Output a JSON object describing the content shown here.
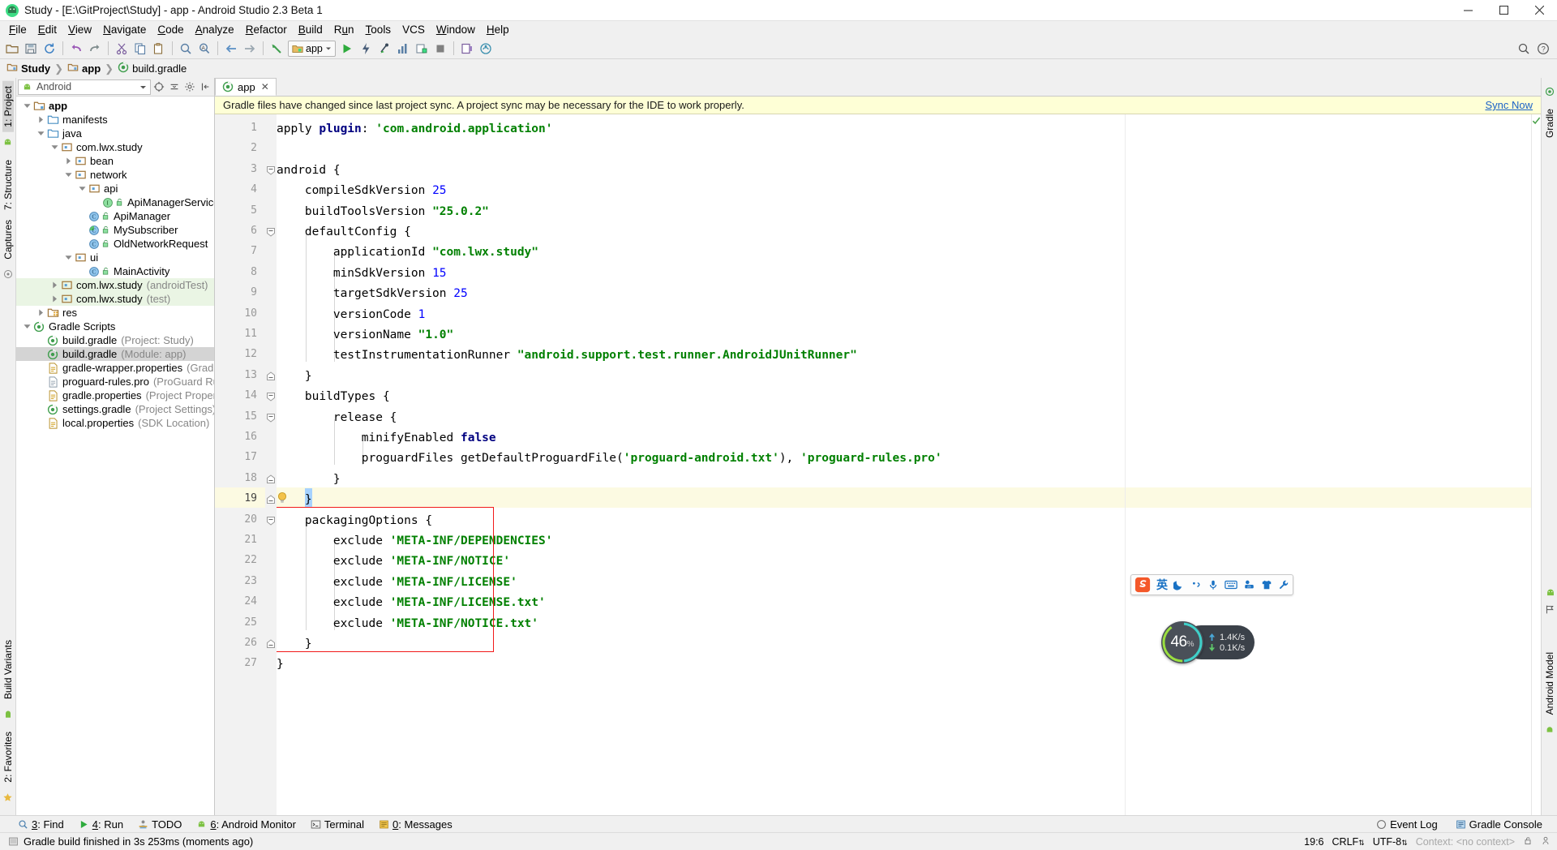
{
  "window": {
    "title": "Study - [E:\\GitProject\\Study] - app - Android Studio 2.3 Beta 1",
    "icon": "android-studio-icon",
    "minimize": "minimize-button",
    "maximize": "maximize-button",
    "close": "close-button"
  },
  "menu": [
    {
      "label": "File",
      "mnemonic": "F"
    },
    {
      "label": "Edit",
      "mnemonic": "E"
    },
    {
      "label": "View",
      "mnemonic": "V"
    },
    {
      "label": "Navigate",
      "mnemonic": "N"
    },
    {
      "label": "Code",
      "mnemonic": "C"
    },
    {
      "label": "Analyze",
      "mnemonic": "A"
    },
    {
      "label": "Refactor",
      "mnemonic": "R"
    },
    {
      "label": "Build",
      "mnemonic": "B"
    },
    {
      "label": "Run",
      "mnemonic": "u"
    },
    {
      "label": "Tools",
      "mnemonic": "T"
    },
    {
      "label": "VCS",
      "mnemonic": ""
    },
    {
      "label": "Window",
      "mnemonic": "W"
    },
    {
      "label": "Help",
      "mnemonic": "H"
    }
  ],
  "toolbar": {
    "run_config": "app",
    "icons": [
      "open-folder-icon",
      "save-all-icon",
      "sync-icon",
      "undo-icon",
      "redo-icon",
      "cut-icon",
      "copy-icon",
      "paste-icon",
      "find-icon",
      "replace-icon",
      "back-icon",
      "forward-icon",
      "sync-project-gradle-icon",
      "run-icon",
      "debug-icon",
      "run-coverage-icon",
      "android-monitor-icon",
      "profiler-icon",
      "stop-icon",
      "avd-manager-icon",
      "sdk-manager-icon"
    ],
    "right_icons": [
      "search-everywhere-icon",
      "help-icon"
    ]
  },
  "breadcrumb": [
    {
      "label": "Study",
      "icon": "module-folder-icon",
      "bold": true
    },
    {
      "label": "app",
      "icon": "module-folder-icon",
      "bold": true
    },
    {
      "label": "build.gradle",
      "icon": "gradle-file-icon",
      "bold": false
    }
  ],
  "left_rail": [
    {
      "label": "1: Project",
      "selected": true
    },
    {
      "label": "7: Structure",
      "selected": false
    },
    {
      "label": "Captures",
      "selected": false
    },
    {
      "label": "Build Variants",
      "selected": false
    },
    {
      "label": "2: Favorites",
      "selected": false
    }
  ],
  "right_rail": [
    {
      "label": "Gradle"
    },
    {
      "label": "Android Model"
    }
  ],
  "project_panel": {
    "view_selector": "Android",
    "view_icon": "android-head-icon",
    "header_buttons": [
      "target-icon",
      "collapse-all-icon",
      "settings-icon",
      "hide-icon"
    ],
    "tree": [
      {
        "depth": 0,
        "twisty": "down",
        "icon": "module-folder-icon",
        "label": "app",
        "sub": "",
        "bold": true,
        "state": "normal"
      },
      {
        "depth": 1,
        "twisty": "right",
        "icon": "folder-icon",
        "label": "manifests",
        "sub": "",
        "bold": false,
        "state": "normal"
      },
      {
        "depth": 1,
        "twisty": "down",
        "icon": "folder-icon",
        "label": "java",
        "sub": "",
        "bold": false,
        "state": "normal"
      },
      {
        "depth": 2,
        "twisty": "down",
        "icon": "package-icon",
        "label": "com.lwx.study",
        "sub": "",
        "bold": false,
        "state": "normal"
      },
      {
        "depth": 3,
        "twisty": "right",
        "icon": "package-icon",
        "label": "bean",
        "sub": "",
        "bold": false,
        "state": "normal"
      },
      {
        "depth": 3,
        "twisty": "down",
        "icon": "package-icon",
        "label": "network",
        "sub": "",
        "bold": false,
        "state": "normal"
      },
      {
        "depth": 4,
        "twisty": "down",
        "icon": "package-icon",
        "label": "api",
        "sub": "",
        "bold": false,
        "state": "normal"
      },
      {
        "depth": 5,
        "twisty": "none",
        "icon": "interface-icon",
        "label": "ApiManagerService",
        "sub": "",
        "bold": false,
        "state": "normal"
      },
      {
        "depth": 4,
        "twisty": "none",
        "icon": "class-icon",
        "label": "ApiManager",
        "sub": "",
        "bold": false,
        "state": "normal"
      },
      {
        "depth": 4,
        "twisty": "none",
        "icon": "class-abstract-icon",
        "label": "MySubscriber",
        "sub": "",
        "bold": false,
        "state": "normal"
      },
      {
        "depth": 4,
        "twisty": "none",
        "icon": "class-icon",
        "label": "OldNetworkRequest",
        "sub": "",
        "bold": false,
        "state": "normal"
      },
      {
        "depth": 3,
        "twisty": "down",
        "icon": "package-icon",
        "label": "ui",
        "sub": "",
        "bold": false,
        "state": "normal"
      },
      {
        "depth": 4,
        "twisty": "none",
        "icon": "class-icon",
        "label": "MainActivity",
        "sub": "",
        "bold": false,
        "state": "normal"
      },
      {
        "depth": 2,
        "twisty": "right",
        "icon": "package-icon",
        "label": "com.lwx.study",
        "sub": "(androidTest)",
        "bold": false,
        "state": "test"
      },
      {
        "depth": 2,
        "twisty": "right",
        "icon": "package-icon",
        "label": "com.lwx.study",
        "sub": "(test)",
        "bold": false,
        "state": "test"
      },
      {
        "depth": 1,
        "twisty": "right",
        "icon": "res-folder-icon",
        "label": "res",
        "sub": "",
        "bold": false,
        "state": "normal"
      },
      {
        "depth": 0,
        "twisty": "down",
        "icon": "gradle-file-icon",
        "label": "Gradle Scripts",
        "sub": "",
        "bold": false,
        "state": "normal"
      },
      {
        "depth": 1,
        "twisty": "none",
        "icon": "gradle-file-icon",
        "label": "build.gradle",
        "sub": "(Project: Study)",
        "bold": false,
        "state": "normal"
      },
      {
        "depth": 1,
        "twisty": "none",
        "icon": "gradle-file-icon",
        "label": "build.gradle",
        "sub": "(Module: app)",
        "bold": false,
        "state": "selected"
      },
      {
        "depth": 1,
        "twisty": "none",
        "icon": "properties-icon",
        "label": "gradle-wrapper.properties",
        "sub": "(Gradle Version)",
        "bold": false,
        "state": "normal"
      },
      {
        "depth": 1,
        "twisty": "none",
        "icon": "text-file-icon",
        "label": "proguard-rules.pro",
        "sub": "(ProGuard Rules for",
        "bold": false,
        "state": "normal"
      },
      {
        "depth": 1,
        "twisty": "none",
        "icon": "properties-icon",
        "label": "gradle.properties",
        "sub": "(Project Properties)",
        "bold": false,
        "state": "normal"
      },
      {
        "depth": 1,
        "twisty": "none",
        "icon": "gradle-file-icon",
        "label": "settings.gradle",
        "sub": "(Project Settings)",
        "bold": false,
        "state": "normal"
      },
      {
        "depth": 1,
        "twisty": "none",
        "icon": "properties-icon",
        "label": "local.properties",
        "sub": "(SDK Location)",
        "bold": false,
        "state": "normal"
      }
    ]
  },
  "editor": {
    "tab": {
      "label": "app",
      "icon": "gradle-file-icon",
      "close": "close-tab-icon"
    },
    "notification": {
      "message": "Gradle files have changed since last project sync. A project sync may be necessary for the IDE to work properly.",
      "action": "Sync Now"
    },
    "first_line": 1,
    "lines": [
      {
        "n": 1,
        "text": "apply plugin: 'com.android.application'"
      },
      {
        "n": 2,
        "text": ""
      },
      {
        "n": 3,
        "text": "android {"
      },
      {
        "n": 4,
        "text": "    compileSdkVersion 25"
      },
      {
        "n": 5,
        "text": "    buildToolsVersion \"25.0.2\""
      },
      {
        "n": 6,
        "text": "    defaultConfig {"
      },
      {
        "n": 7,
        "text": "        applicationId \"com.lwx.study\""
      },
      {
        "n": 8,
        "text": "        minSdkVersion 15"
      },
      {
        "n": 9,
        "text": "        targetSdkVersion 25"
      },
      {
        "n": 10,
        "text": "        versionCode 1"
      },
      {
        "n": 11,
        "text": "        versionName \"1.0\""
      },
      {
        "n": 12,
        "text": "        testInstrumentationRunner \"android.support.test.runner.AndroidJUnitRunner\""
      },
      {
        "n": 13,
        "text": "    }"
      },
      {
        "n": 14,
        "text": "    buildTypes {"
      },
      {
        "n": 15,
        "text": "        release {"
      },
      {
        "n": 16,
        "text": "            minifyEnabled false"
      },
      {
        "n": 17,
        "text": "            proguardFiles getDefaultProguardFile('proguard-android.txt'), 'proguard-rules.pro'"
      },
      {
        "n": 18,
        "text": "        }"
      },
      {
        "n": 19,
        "text": "    }"
      },
      {
        "n": 20,
        "text": "    packagingOptions {"
      },
      {
        "n": 21,
        "text": "        exclude 'META-INF/DEPENDENCIES'"
      },
      {
        "n": 22,
        "text": "        exclude 'META-INF/NOTICE'"
      },
      {
        "n": 23,
        "text": "        exclude 'META-INF/LICENSE'"
      },
      {
        "n": 24,
        "text": "        exclude 'META-INF/LICENSE.txt'"
      },
      {
        "n": 25,
        "text": "        exclude 'META-INF/NOTICE.txt'"
      },
      {
        "n": 26,
        "text": "    }"
      },
      {
        "n": 27,
        "text": "}"
      }
    ],
    "caret_line": 19,
    "intention_bulb": "intention-bulb-icon",
    "highlight_box_lines": [
      20,
      26
    ]
  },
  "bottom_tools": [
    {
      "label": "3: Find",
      "icon": "find-icon",
      "mnemonic": "3"
    },
    {
      "label": "4: Run",
      "icon": "run-icon",
      "mnemonic": "4"
    },
    {
      "label": "TODO",
      "icon": "todo-icon",
      "mnemonic": ""
    },
    {
      "label": "6: Android Monitor",
      "icon": "android-head-icon",
      "mnemonic": "6"
    },
    {
      "label": "Terminal",
      "icon": "terminal-icon",
      "mnemonic": ""
    },
    {
      "label": "0: Messages",
      "icon": "messages-icon",
      "mnemonic": "0"
    }
  ],
  "bottom_right": [
    {
      "label": "Event Log",
      "icon": "event-log-icon"
    },
    {
      "label": "Gradle Console",
      "icon": "gradle-console-icon"
    }
  ],
  "status": {
    "icon": "build-status-icon",
    "message": "Gradle build finished in 3s 253ms (moments ago)",
    "caret_position": "19:6",
    "line_separator": "CRLF",
    "encoding": "UTF-8",
    "context": "Context: <no context>",
    "lock_icon": "unlocked-icon",
    "inspection_icon": "inspector-icon"
  },
  "floating": {
    "network_monitor": {
      "percent": "46",
      "percent_symbol": "%",
      "upload": "1.4K/s",
      "download": "0.1K/s",
      "upload_icon": "arrow-up-icon",
      "download_icon": "arrow-down-icon"
    },
    "ime_bar": {
      "logo": "sogou-logo-icon",
      "items": [
        "chinese-english-toggle-icon",
        "moon-icon",
        "comma-icon",
        "voice-input-icon",
        "soft-keyboard-icon",
        "emoji-icon",
        "skin-icon",
        "settings-wrench-icon"
      ]
    },
    "system_rail": [
      "android-head-icon",
      "flag-icon"
    ],
    "right_label": "Android Model"
  },
  "colors": {
    "accent": "#1a61c7",
    "notification_bg": "#feffd6",
    "caret_line": "#fcfae2",
    "highlight_box": "#f21a1a",
    "test_row": "#eaf5e4",
    "selection": "#a6d2ff",
    "string": "#008000",
    "number": "#0000ff",
    "keyword": "#000080"
  }
}
